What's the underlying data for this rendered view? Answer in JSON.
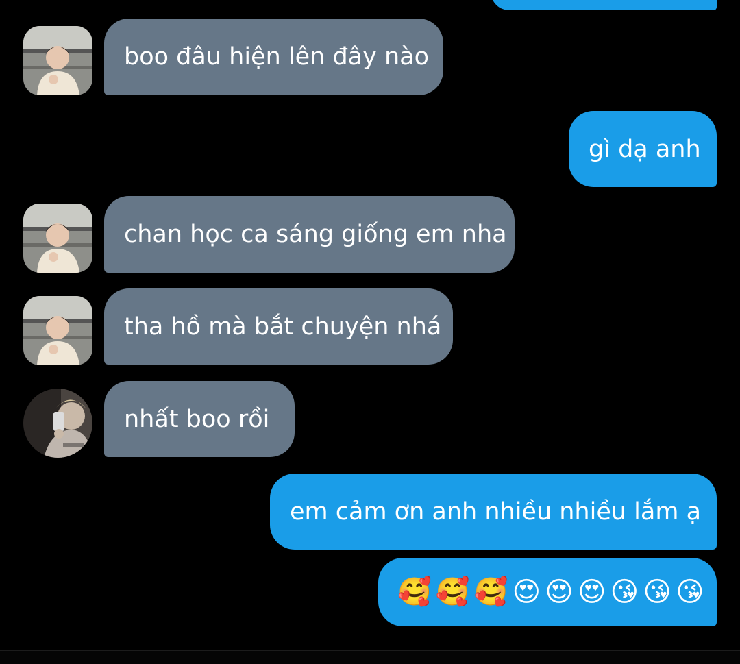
{
  "colors": {
    "background": "#000000",
    "incoming_bubble": "#667788",
    "outgoing_bubble": "#1a9de8",
    "text": "#ffffff"
  },
  "messages": [
    {
      "direction": "outgoing",
      "text": ""
    },
    {
      "direction": "incoming",
      "sender_avatar": "avatar-photo-boy-hoodie",
      "text": "boo đâu hiện lên đây nào"
    },
    {
      "direction": "outgoing",
      "text": "gì dạ anh"
    },
    {
      "direction": "incoming",
      "sender_avatar": "avatar-photo-boy-hoodie",
      "text": "chan học ca sáng giống em nha"
    },
    {
      "direction": "incoming",
      "sender_avatar": "avatar-photo-boy-hoodie",
      "text": "tha hồ mà bắt chuyện nhá"
    },
    {
      "direction": "incoming",
      "sender_avatar": "avatar-photo-mirror-selfie",
      "text": "nhất boo rồi"
    },
    {
      "direction": "outgoing",
      "text": "em cảm ơn anh nhiều nhiều lắm ạ"
    },
    {
      "direction": "outgoing",
      "emojis": [
        "🥰",
        "🥰",
        "🥰",
        "😍",
        "😍",
        "😍",
        "😘",
        "😘",
        "😘"
      ]
    }
  ]
}
